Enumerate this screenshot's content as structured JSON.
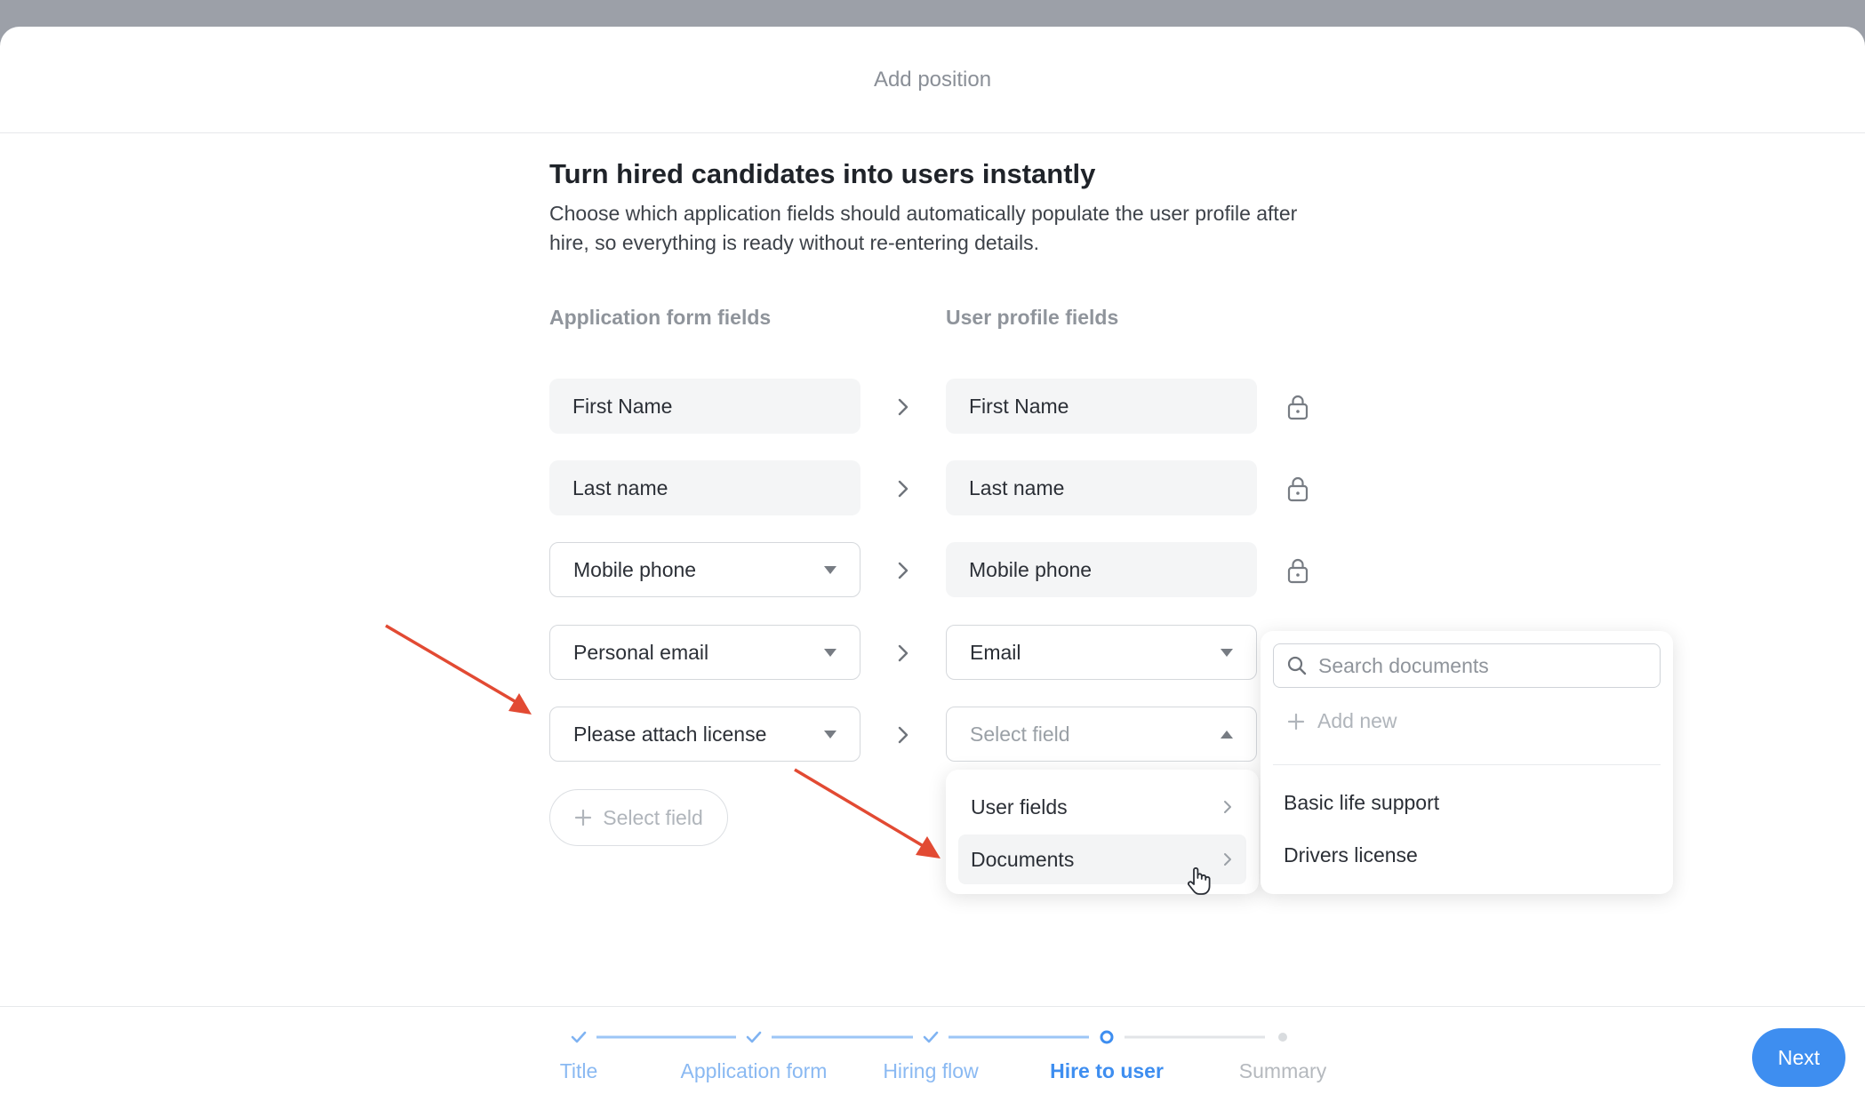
{
  "modal": {
    "title": "Add position"
  },
  "intro": {
    "heading": "Turn hired candidates into users instantly",
    "description": "Choose which application fields should automatically populate the user profile after hire, so everything is ready without re-entering details."
  },
  "columns": {
    "application_label": "Application form fields",
    "profile_label": "User profile fields"
  },
  "rows": [
    {
      "app_field": "First Name",
      "profile_field": "First Name"
    },
    {
      "app_field": "Last name",
      "profile_field": "Last name"
    },
    {
      "app_field": "Mobile phone",
      "profile_field": "Mobile phone"
    },
    {
      "app_field": "Personal email",
      "profile_field": "Email"
    },
    {
      "app_field": "Please attach license",
      "profile_placeholder": "Select field"
    }
  ],
  "add_field_label": "Select field",
  "field_menu": {
    "items": [
      "User fields",
      "Documents"
    ]
  },
  "documents_menu": {
    "search_placeholder": "Search documents",
    "add_new": "Add new",
    "items": [
      "Basic life support",
      "Drivers license"
    ]
  },
  "steps": {
    "labels": [
      "Title",
      "Application form",
      "Hiring flow",
      "Hire to user",
      "Summary"
    ],
    "current_index": 3
  },
  "next_label": "Next",
  "colors": {
    "accent": "#3e8ef0",
    "annotation_arrow": "#e24a33"
  }
}
